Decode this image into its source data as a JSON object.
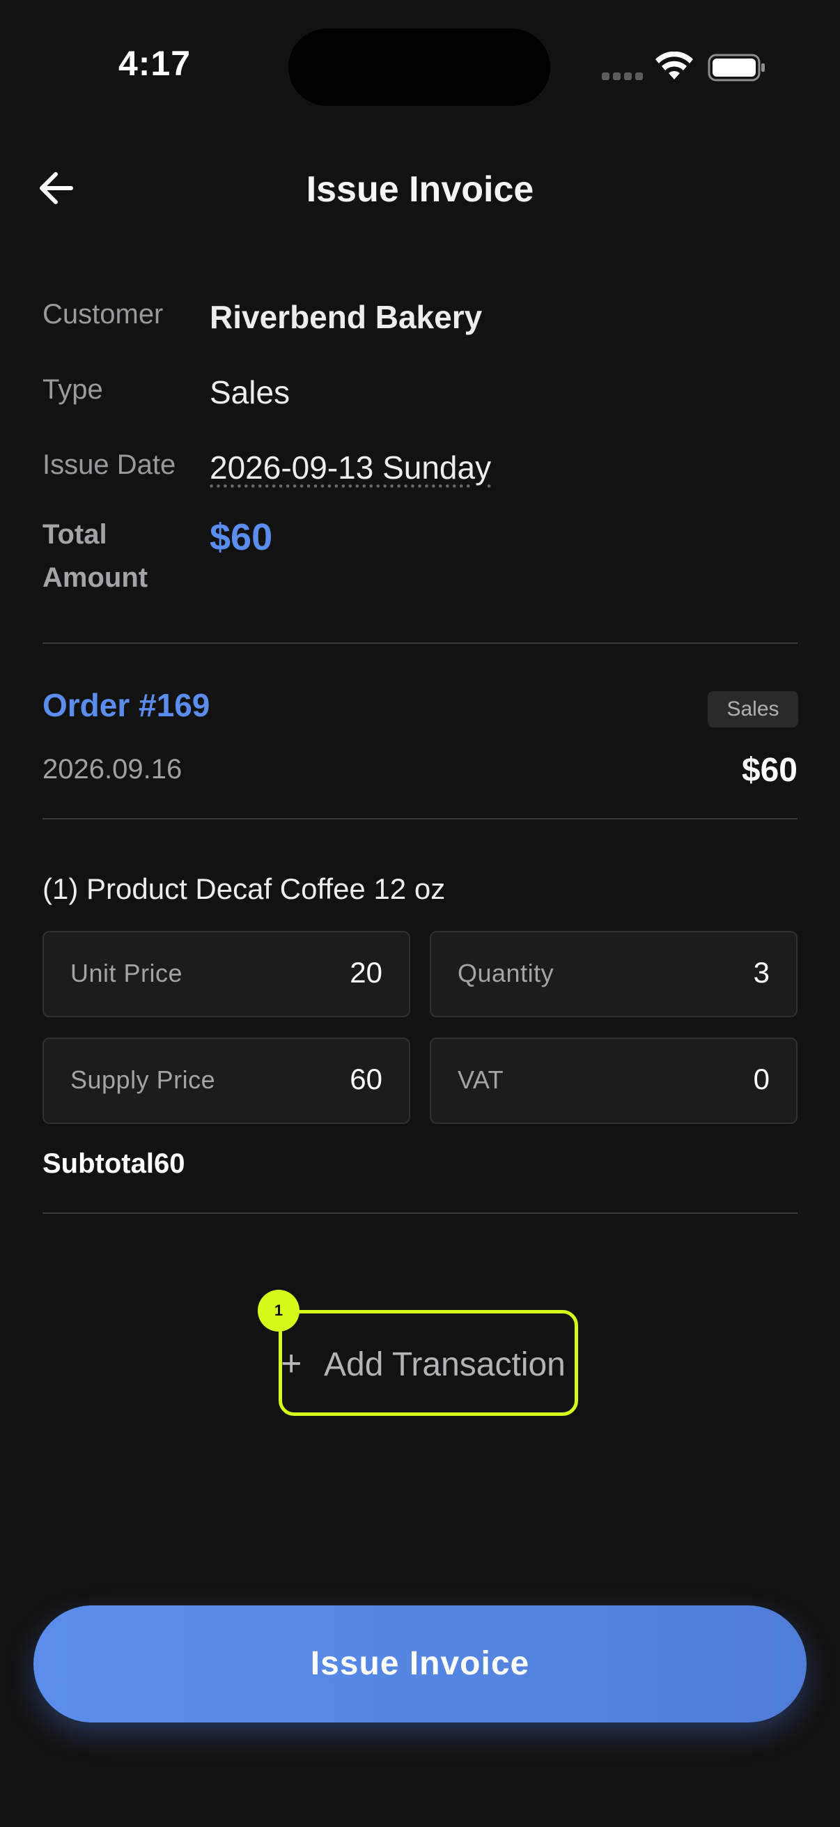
{
  "status_bar": {
    "time": "4:17"
  },
  "header": {
    "title": "Issue Invoice",
    "back_icon": "arrow-left-icon"
  },
  "info": {
    "customer_label": "Customer",
    "customer_value": "Riverbend Bakery",
    "type_label": "Type",
    "type_value": "Sales",
    "issue_date_label": "Issue Date",
    "issue_date_value": "2026-09-13 Sunday",
    "total_label": "Total Amount",
    "total_value": "$60"
  },
  "order": {
    "title": "Order #169",
    "badge": "Sales",
    "date": "2026.09.16",
    "amount": "$60"
  },
  "product": {
    "title": "(1) Product Decaf Coffee 12 oz",
    "unit_price_label": "Unit Price",
    "unit_price_value": "20",
    "quantity_label": "Quantity",
    "quantity_value": "3",
    "supply_price_label": "Supply Price",
    "supply_price_value": "60",
    "vat_label": "VAT",
    "vat_value": "0",
    "subtotal": "Subtotal60"
  },
  "add_transaction": {
    "plus": "+",
    "label": "Add Transaction",
    "marker": "1"
  },
  "footer": {
    "issue_button": "Issue Invoice"
  },
  "colors": {
    "accent": "#5b8def",
    "highlight": "#d6fa1a",
    "background": "#121213"
  }
}
